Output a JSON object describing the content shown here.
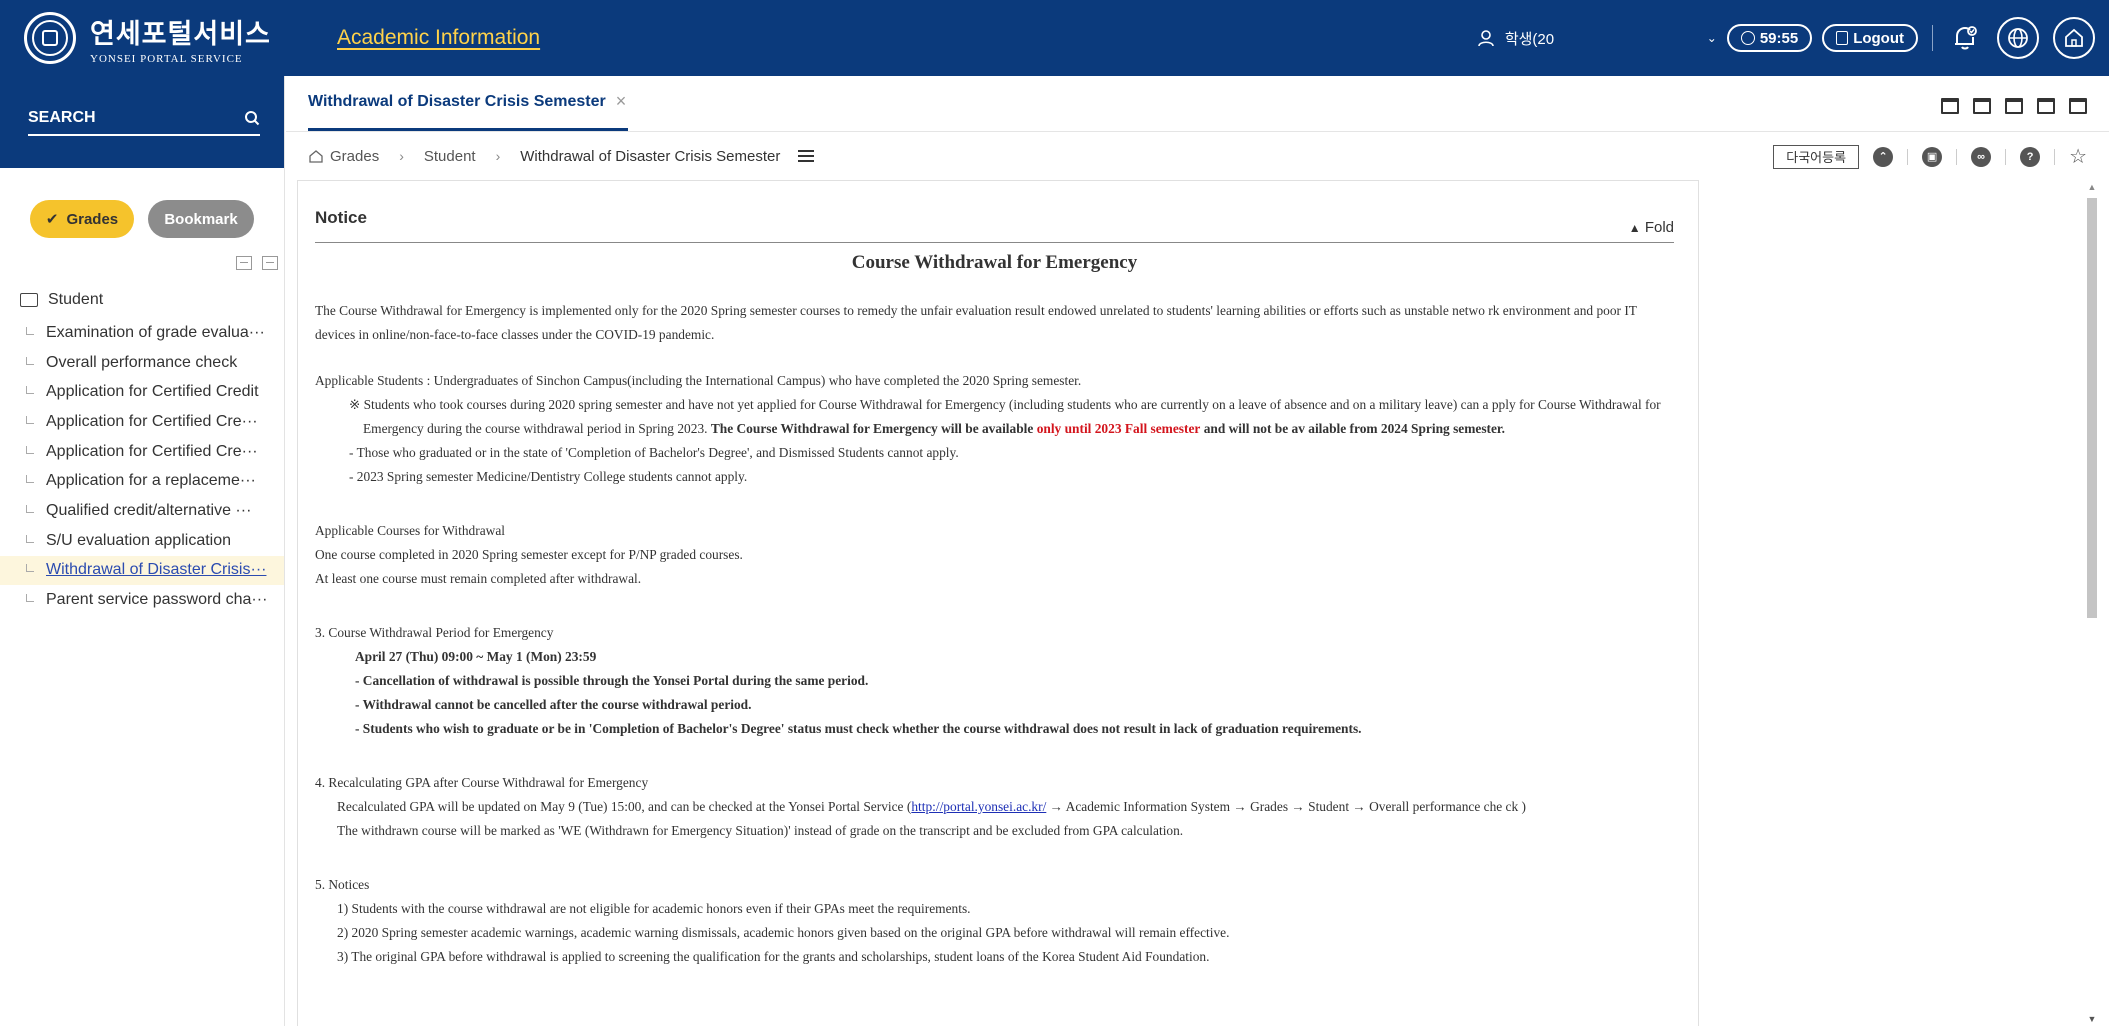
{
  "header": {
    "logo_ko": "연세포털서비스",
    "logo_en": "YONSEI PORTAL SERVICE",
    "section_title": "Academic Information",
    "user_label": "학생(20",
    "timer": "59:55",
    "logout_label": "Logout"
  },
  "sidebar": {
    "search_label": "SEARCH",
    "toggle_grades": "Grades",
    "toggle_bookmark": "Bookmark",
    "root_label": "Student",
    "items": [
      {
        "label": "Examination of grade evalua···"
      },
      {
        "label": "Overall performance check"
      },
      {
        "label": "Application for Certified Credit"
      },
      {
        "label": "Application for Certified Cre···"
      },
      {
        "label": "Application for Certified Cre···"
      },
      {
        "label": "Application for a replaceme···"
      },
      {
        "label": "Qualified credit/alternative ···"
      },
      {
        "label": "S/U evaluation application"
      },
      {
        "label": "Withdrawal of Disaster Crisis···"
      },
      {
        "label": "Parent service password cha···"
      }
    ],
    "selected_index": 8
  },
  "tab": {
    "label": "Withdrawal of Disaster Crisis Semester"
  },
  "breadcrumb": {
    "home": "Grades",
    "level2": "Student",
    "level3": "Withdrawal of Disaster Crisis Semester",
    "lang_button": "다국어등록"
  },
  "notice": {
    "heading": "Notice",
    "fold_label": "Fold",
    "title": "Course Withdrawal for Emergency",
    "intro": "The Course Withdrawal for Emergency is implemented only for the 2020 Spring semester courses to remedy the unfair evaluation result endowed unrelated to students' learning abilities or efforts such as unstable netwo rk environment and poor IT devices in online/non-face-to-face classes under the COVID-19 pandemic.",
    "applicable_students": "Applicable Students : Undergraduates of Sinchon Campus(including the International Campus) who have completed the 2020 Spring semester.",
    "asterisk_note": "※ Students who took courses during 2020 spring semester and have not yet applied for Course Withdrawal for Emergency (including students who are currently on a leave of absence and on a military leave) can a pply for Course Withdrawal for Emergency during the course withdrawal period in Spring 2023.",
    "availability_bold_1": "The Course Withdrawal for Emergency will be available",
    "availability_red": "only until 2023 Fall semester",
    "availability_bold_2": "and will not be av ailable from 2024 Spring semester.",
    "excluded_1": "- Those who graduated or in the state of 'Completion of Bachelor's Degree', and Dismissed Students cannot apply.",
    "excluded_2": "- 2023 Spring semester Medicine/Dentistry College students cannot apply.",
    "courses_heading": "Applicable Courses for Withdrawal",
    "courses_1": "One course completed in 2020 Spring semester except for P/NP graded courses.",
    "courses_2": "At least one course must remain completed after withdrawal.",
    "period_heading": "3. Course Withdrawal Period for Emergency",
    "period_dates": "April 27 (Thu) 09:00 ~ May 1 (Mon) 23:59",
    "period_1": "- Cancellation of withdrawal is possible through the Yonsei Portal during the same period.",
    "period_2": "- Withdrawal cannot be cancelled after the course withdrawal period.",
    "period_3": "- Students who wish to graduate or be in 'Completion of Bachelor's Degree' status must check whether the course withdrawal does not result in lack of graduation requirements.",
    "gpa_heading": "4. Recalculating GPA after Course Withdrawal for Emergency",
    "gpa_1a": "Recalculated GPA will be updated on May 9 (Tue) 15:00, and can be checked at the Yonsei Portal Service (",
    "gpa_link": "http://portal.yonsei.ac.kr/",
    "gpa_1b": " → Academic Information System → Grades → Student → Overall performance che ck )",
    "gpa_2": "The withdrawn course will be marked as 'WE (Withdrawn for Emergency Situation)' instead of grade on the transcript and be excluded from GPA calculation.",
    "notices_heading": "5. Notices",
    "notice_1": "1) Students with the course withdrawal are not eligible for academic honors even if their GPAs meet the requirements.",
    "notice_2": "2) 2020 Spring semester academic warnings, academic warning dismissals, academic honors given based on the original GPA before withdrawal will remain effective.",
    "notice_3": "3) The original GPA before withdrawal is applied to screening the qualification for the grants and scholarships, student loans of the Korea Student Aid Foundation."
  },
  "colors": {
    "brand_navy": "#0b3a7c",
    "accent_yellow": "#f5c32c",
    "highlight_red": "#d3141c"
  }
}
